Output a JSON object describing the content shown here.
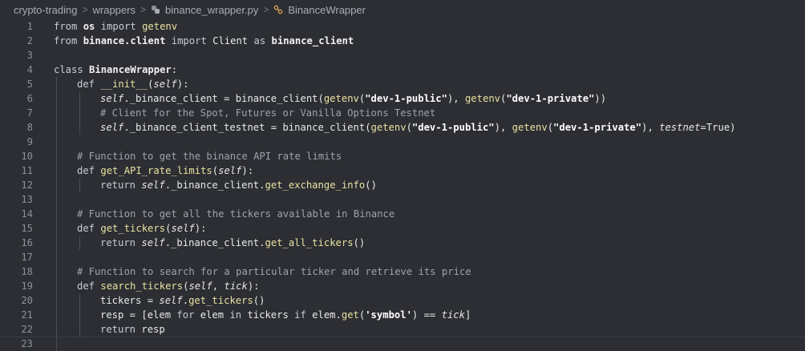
{
  "breadcrumb": {
    "items": [
      "crypto-trading",
      "wrappers",
      "binance_wrapper.py",
      "BinanceWrapper"
    ],
    "separator": ">"
  },
  "code": {
    "lines": [
      {
        "n": "1",
        "i": 0,
        "t": [
          [
            "kw",
            "from "
          ],
          [
            "mod",
            "os"
          ],
          [
            "kw",
            " import "
          ],
          [
            "fn",
            "getenv"
          ]
        ]
      },
      {
        "n": "2",
        "i": 0,
        "t": [
          [
            "kw",
            "from "
          ],
          [
            "mod",
            "binance.client"
          ],
          [
            "kw",
            " import "
          ],
          [
            "",
            "Client "
          ],
          [
            "kw",
            "as "
          ],
          [
            "mod",
            "binance_client"
          ]
        ]
      },
      {
        "n": "3",
        "i": 0,
        "t": []
      },
      {
        "n": "4",
        "i": 0,
        "t": [
          [
            "kw",
            "class "
          ],
          [
            "cls",
            "BinanceWrapper"
          ],
          [
            "",
            ":"
          ]
        ]
      },
      {
        "n": "5",
        "i": 1,
        "t": [
          [
            "kw",
            "def "
          ],
          [
            "fn",
            "__init__"
          ],
          [
            "",
            "("
          ],
          [
            "self",
            "self"
          ],
          [
            "",
            "):"
          ]
        ]
      },
      {
        "n": "6",
        "i": 2,
        "t": [
          [
            "self",
            "self"
          ],
          [
            "",
            "._binance_client = binance_client("
          ],
          [
            "fn",
            "getenv"
          ],
          [
            "",
            "("
          ],
          [
            "str",
            "\"dev-1-public\""
          ],
          [
            "",
            "), "
          ],
          [
            "fn",
            "getenv"
          ],
          [
            "",
            "("
          ],
          [
            "str",
            "\"dev-1-private\""
          ],
          [
            "",
            "))"
          ]
        ]
      },
      {
        "n": "7",
        "i": 2,
        "t": [
          [
            "cm",
            "# Client for the Spot, Futures or Vanilla Options Testnet"
          ]
        ]
      },
      {
        "n": "8",
        "i": 2,
        "t": [
          [
            "self",
            "self"
          ],
          [
            "",
            "._binance_client_testnet = binance_client("
          ],
          [
            "fn",
            "getenv"
          ],
          [
            "",
            "("
          ],
          [
            "str",
            "\"dev-1-public\""
          ],
          [
            "",
            "), "
          ],
          [
            "fn",
            "getenv"
          ],
          [
            "",
            "("
          ],
          [
            "str",
            "\"dev-1-private\""
          ],
          [
            "",
            "), "
          ],
          [
            "self",
            "testnet"
          ],
          [
            "",
            "=True)"
          ]
        ]
      },
      {
        "n": "9",
        "i": 0,
        "t": []
      },
      {
        "n": "10",
        "i": 1,
        "t": [
          [
            "cm",
            "# Function to get the binance API rate limits"
          ]
        ]
      },
      {
        "n": "11",
        "i": 1,
        "t": [
          [
            "kw",
            "def "
          ],
          [
            "fn",
            "get_API_rate_limits"
          ],
          [
            "",
            "("
          ],
          [
            "self",
            "self"
          ],
          [
            "",
            "):"
          ]
        ]
      },
      {
        "n": "12",
        "i": 2,
        "t": [
          [
            "kw",
            "return "
          ],
          [
            "self",
            "self"
          ],
          [
            "",
            "._binance_client."
          ],
          [
            "fn",
            "get_exchange_info"
          ],
          [
            "",
            "()"
          ]
        ]
      },
      {
        "n": "13",
        "i": 0,
        "t": []
      },
      {
        "n": "14",
        "i": 1,
        "t": [
          [
            "cm",
            "# Function to get all the tickers available in Binance"
          ]
        ]
      },
      {
        "n": "15",
        "i": 1,
        "t": [
          [
            "kw",
            "def "
          ],
          [
            "fn",
            "get_tickers"
          ],
          [
            "",
            "("
          ],
          [
            "self",
            "self"
          ],
          [
            "",
            "):"
          ]
        ]
      },
      {
        "n": "16",
        "i": 2,
        "t": [
          [
            "kw",
            "return "
          ],
          [
            "self",
            "self"
          ],
          [
            "",
            "._binance_client."
          ],
          [
            "fn",
            "get_all_tickers"
          ],
          [
            "",
            "()"
          ]
        ]
      },
      {
        "n": "17",
        "i": 0,
        "t": []
      },
      {
        "n": "18",
        "i": 1,
        "t": [
          [
            "cm",
            "# Function to search for a particular ticker and retrieve its price"
          ]
        ]
      },
      {
        "n": "19",
        "i": 1,
        "t": [
          [
            "kw",
            "def "
          ],
          [
            "fn",
            "search_tickers"
          ],
          [
            "",
            "("
          ],
          [
            "self",
            "self"
          ],
          [
            "",
            ", "
          ],
          [
            "self",
            "tick"
          ],
          [
            "",
            "):"
          ]
        ]
      },
      {
        "n": "20",
        "i": 2,
        "t": [
          [
            "",
            "tickers = "
          ],
          [
            "self",
            "self"
          ],
          [
            "",
            "."
          ],
          [
            "fn",
            "get_tickers"
          ],
          [
            "",
            "()"
          ]
        ]
      },
      {
        "n": "21",
        "i": 2,
        "t": [
          [
            "",
            "resp = [elem "
          ],
          [
            "kw",
            "for "
          ],
          [
            "",
            "elem "
          ],
          [
            "kw",
            "in "
          ],
          [
            "",
            "tickers "
          ],
          [
            "kw",
            "if "
          ],
          [
            "",
            "elem."
          ],
          [
            "fn",
            "get"
          ],
          [
            "",
            "("
          ],
          [
            "str",
            "'symbol'"
          ],
          [
            "",
            ") == "
          ],
          [
            "self",
            "tick"
          ],
          [
            "",
            "]"
          ]
        ]
      },
      {
        "n": "22",
        "i": 2,
        "t": [
          [
            "kw",
            "return "
          ],
          [
            "",
            "resp"
          ]
        ]
      },
      {
        "n": "23",
        "i": 0,
        "t": []
      }
    ]
  },
  "icons": {
    "file": "python-file-icon",
    "symbol": "class-symbol-icon"
  },
  "colors": {
    "background": "#2c2e33",
    "function": "#e9e2a2"
  }
}
